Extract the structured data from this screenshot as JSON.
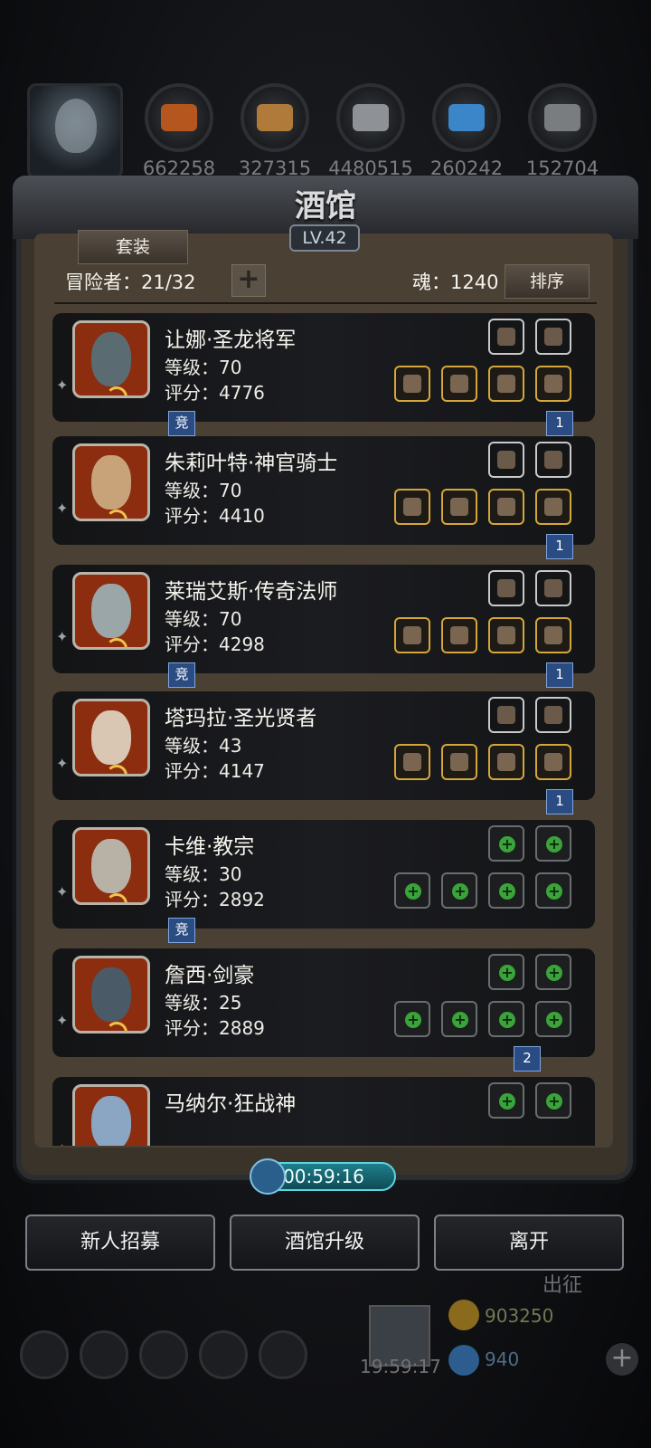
{
  "resources": [
    {
      "name": "meat-icon",
      "value": "662258",
      "color": "#b5561e"
    },
    {
      "name": "wood-icon",
      "value": "327315",
      "color": "#b07a3b"
    },
    {
      "name": "stone-icon",
      "value": "4480515",
      "color": "#8e9196"
    },
    {
      "name": "crystal-icon",
      "value": "260242",
      "color": "#3a86c9"
    },
    {
      "name": "iron-icon",
      "value": "152704",
      "color": "#7a7d80"
    }
  ],
  "panel": {
    "title": "酒馆",
    "level": "LV.42",
    "set_tab": "套装",
    "adventurer_count": "冒险者：21/32",
    "soul": "魂：1240",
    "sort_label": "排序"
  },
  "heroes": [
    {
      "name": "让娜·圣龙将军",
      "level": "等级：70",
      "score": "评分：4776",
      "portrait_color": "#5a6b72",
      "top_slots": [
        "sword-icon",
        "axe-icon"
      ],
      "bottom_slots": [
        "longsword-icon",
        "robe-icon",
        "ring-icon",
        "boots-icon"
      ],
      "empty": false,
      "tag_left": "竞",
      "tag_right": "1"
    },
    {
      "name": "朱莉叶特·神官骑士",
      "level": "等级：70",
      "score": "评分：4410",
      "portrait_color": "#c8a37a",
      "top_slots": [
        "gauntlet-icon",
        "gauntlet-icon"
      ],
      "bottom_slots": [
        "mace-icon",
        "robe-icon",
        "armor-icon",
        "amulet-icon"
      ],
      "empty": false,
      "tag_left": "",
      "tag_right": "1"
    },
    {
      "name": "莱瑞艾斯·传奇法师",
      "level": "等级：70",
      "score": "评分：4298",
      "portrait_color": "#9aa6a8",
      "top_slots": [
        "bracelet-icon",
        "scroll-icon"
      ],
      "bottom_slots": [
        "staff-icon",
        "robe-icon",
        "armor-icon",
        "amulet-icon"
      ],
      "empty": false,
      "tag_left": "竞",
      "tag_right": "1"
    },
    {
      "name": "塔玛拉·圣光贤者",
      "level": "等级：43",
      "score": "评分：4147",
      "portrait_color": "#d9c7b4",
      "top_slots": [
        "necklace-icon",
        "book-icon"
      ],
      "bottom_slots": [
        "hammer-icon",
        "robe-icon",
        "armor-icon",
        "gloves-icon"
      ],
      "empty": false,
      "tag_left": "",
      "tag_right": "1"
    },
    {
      "name": "卡维·教宗",
      "level": "等级：30",
      "score": "评分：2892",
      "portrait_color": "#b8b2a6",
      "top_slots": [
        "add-icon",
        "add-icon"
      ],
      "bottom_slots": [
        "add-icon",
        "add-icon",
        "add-icon",
        "add-icon"
      ],
      "empty": true,
      "tag_left": "竞",
      "tag_right": ""
    },
    {
      "name": "詹西·剑豪",
      "level": "等级：25",
      "score": "评分：2889",
      "portrait_color": "#4a5a66",
      "top_slots": [
        "add-icon",
        "add-icon"
      ],
      "bottom_slots": [
        "add-icon",
        "add-icon",
        "add-icon",
        "add-icon"
      ],
      "empty": true,
      "tag_left": "",
      "tag_right": "2"
    },
    {
      "name": "马纳尔·狂战神",
      "level": "",
      "score": "",
      "portrait_color": "#8aa6c2",
      "top_slots": [
        "add-icon",
        "add-icon"
      ],
      "bottom_slots": [],
      "empty": true,
      "tag_left": "",
      "tag_right": ""
    }
  ],
  "timer": "00:59:16",
  "buttons": {
    "recruit": "新人招募",
    "upgrade": "酒馆升级",
    "leave": "离开"
  },
  "footer": {
    "expedition": "出征",
    "gift_timer": "19:59:17",
    "gold": "903250",
    "gems": "940"
  }
}
